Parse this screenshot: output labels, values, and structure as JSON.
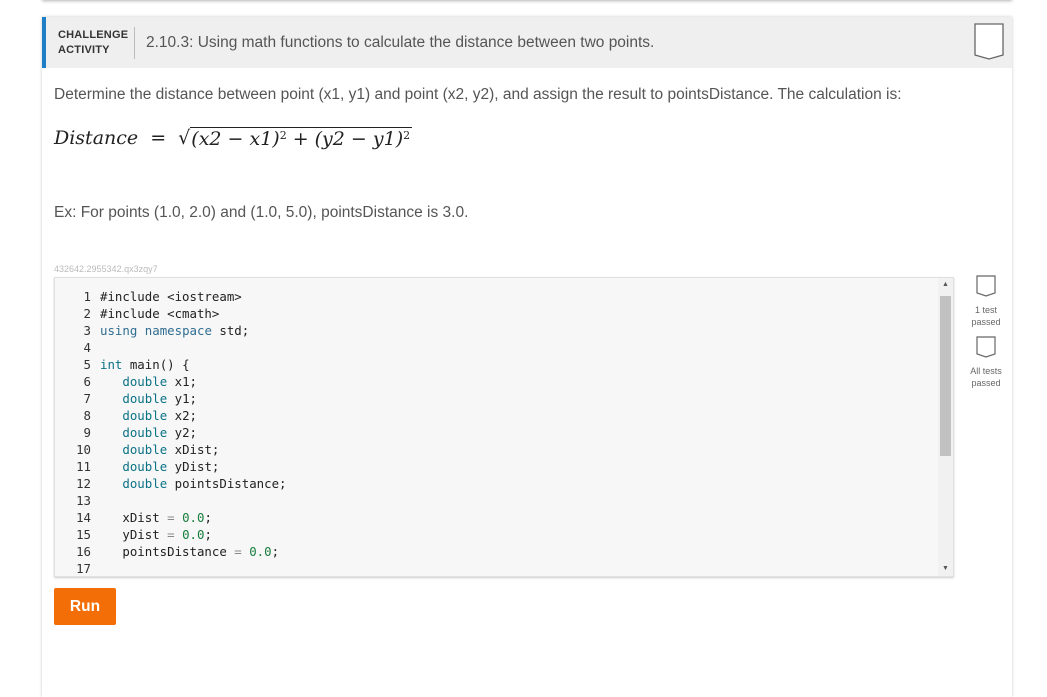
{
  "header": {
    "label_line1": "CHALLENGE",
    "label_line2": "ACTIVITY",
    "title": "2.10.3: Using math functions to calculate the distance between two points."
  },
  "prompt": "Determine the distance between point (x1, y1) and point (x2, y2), and assign the result to pointsDistance. The calculation is:",
  "formula": {
    "lhs": "Distance",
    "equals": "=",
    "sqrt_symbol": "√",
    "term1": "(x2 − x1)",
    "exp1": "2",
    "plus": "+",
    "term2": "(y2 − y1)",
    "exp2": "2"
  },
  "example": "Ex: For points (1.0, 2.0) and (1.0, 5.0), pointsDistance is 3.0.",
  "code_id": "432642.2955342.qx3zqy7",
  "code": {
    "lines": [
      {
        "num": "1",
        "text": "#include <iostream>"
      },
      {
        "num": "2",
        "text": "#include <cmath>"
      },
      {
        "num": "3",
        "text": "using namespace std;"
      },
      {
        "num": "4",
        "text": ""
      },
      {
        "num": "5",
        "text": "int main() {"
      },
      {
        "num": "6",
        "text": "   double x1;"
      },
      {
        "num": "7",
        "text": "   double y1;"
      },
      {
        "num": "8",
        "text": "   double x2;"
      },
      {
        "num": "9",
        "text": "   double y2;"
      },
      {
        "num": "10",
        "text": "   double xDist;"
      },
      {
        "num": "11",
        "text": "   double yDist;"
      },
      {
        "num": "12",
        "text": "   double pointsDistance;"
      },
      {
        "num": "13",
        "text": ""
      },
      {
        "num": "14",
        "text": "   xDist = 0.0;"
      },
      {
        "num": "15",
        "text": "   yDist = 0.0;"
      },
      {
        "num": "16",
        "text": "   pointsDistance = 0.0;"
      },
      {
        "num": "17",
        "text": ""
      }
    ]
  },
  "scrollbar": {
    "up_arrow": "▲",
    "down_arrow": "▼"
  },
  "tests": [
    {
      "label": "1 test passed",
      "icon": "badge-icon"
    },
    {
      "label": "All tests passed",
      "icon": "badge-icon"
    }
  ],
  "run_label": "Run",
  "colors": {
    "accent_blue": "#1e7fc7",
    "run_orange": "#f36e06",
    "header_bg": "#efefef"
  }
}
